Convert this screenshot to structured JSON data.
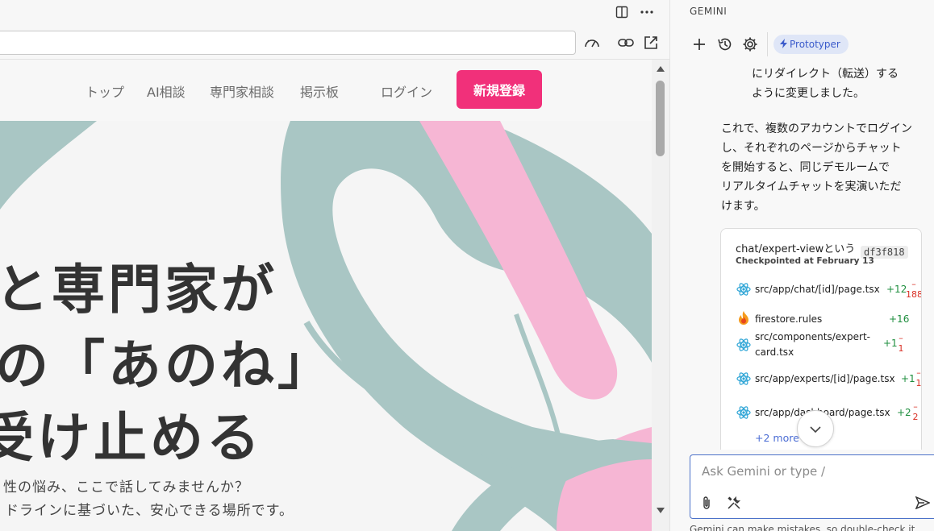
{
  "preview": {
    "url_value": "",
    "nav": [
      "トップ",
      "AI相談",
      "専門家相談",
      "掲示板"
    ],
    "login_label": "ログイン",
    "signup_label": "新規登録",
    "hero_lines": [
      "と専門家が",
      "の「あのね」",
      "受け止める"
    ],
    "hero_sub": [
      "性の悩み、ここで話してみませんか？",
      "ドラインに基づいた、安心できる場所です。"
    ],
    "colors": {
      "signup": "#f1307a",
      "art_teal": "#a9c6c4",
      "art_pink": "#f6b6d4"
    }
  },
  "panel": {
    "title": "GEMINI",
    "mode_chip": "Prototyper",
    "icons": [
      "plus-icon",
      "history-icon",
      "settings-icon",
      "lightning-icon"
    ],
    "messages": [
      "にリダイレクト（転送）する\nように変更しました。",
      "これで、複数のアカウントでログイン\nし、それぞれのページからチャット\nを開始すると、同じデモルームで\nリアルタイムチャットを実演いただ\nけます。"
    ],
    "checkpoint": {
      "title": "chat/expert-viewという",
      "subtitle": "Checkpointed at February 13",
      "hash": "df3f818",
      "files": [
        {
          "name": "src/app/chat/[id]/page.tsx",
          "added": "+12",
          "removed": "188",
          "icon": "react-icon"
        },
        {
          "name": "firestore.rules",
          "added": "+16",
          "removed": "",
          "icon": "firebase-icon"
        },
        {
          "name": "src/components/expert-card.tsx",
          "added": "+1",
          "removed": "1",
          "icon": "react-icon"
        },
        {
          "name": "src/app/experts/[id]/page.tsx",
          "added": "+1",
          "removed": "1",
          "icon": "react-icon"
        },
        {
          "name": "src/app/dashboard/page.tsx",
          "added": "+2",
          "removed": "2",
          "icon": "react-icon"
        }
      ],
      "more": "+2 more"
    },
    "input_placeholder": "Ask Gemini or type /",
    "footer_note": "Gemini can make mistakes, so double-check it"
  }
}
